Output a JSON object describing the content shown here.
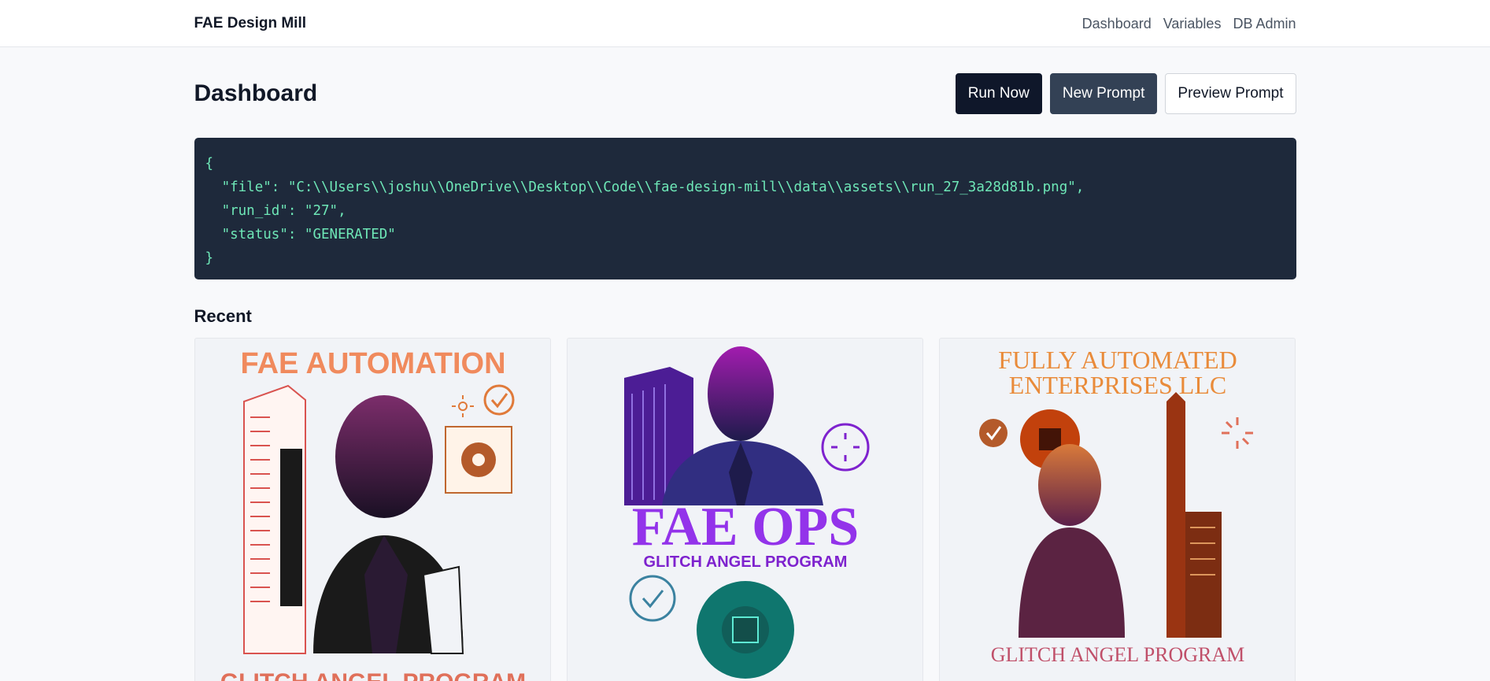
{
  "app": {
    "brand": "FAE Design Mill",
    "nav": [
      "Dashboard",
      "Variables",
      "DB Admin"
    ]
  },
  "page": {
    "title": "Dashboard",
    "buttons": {
      "run_now": "Run Now",
      "new_prompt": "New Prompt",
      "preview_prompt": "Preview Prompt"
    }
  },
  "result_json": "{\n  \"file\": \"C:\\\\Users\\\\joshu\\\\OneDrive\\\\Desktop\\\\Code\\\\fae-design-mill\\\\data\\\\assets\\\\run_27_3a28d81b.png\",\n  \"run_id\": \"27\",\n  \"status\": \"GENERATED\"\n}",
  "recent": {
    "title": "Recent",
    "cards": [
      {
        "headline": "FAE AUTOMATION",
        "footer": "GLITCH ANGEL PROGRAM"
      },
      {
        "headline": "FAE OPS",
        "subline": "GLITCH ANGEL PROGRAM"
      },
      {
        "headline_line1": "FULLY AUTOMATED",
        "headline_line2": "ENTERPRISES LLC",
        "footer": "GLITCH ANGEL PROGRAM"
      }
    ]
  },
  "colors": {
    "accent_dark": "#0f172a",
    "accent_slate": "#334155",
    "code_bg": "#1e293b",
    "code_text": "#6ee7b7"
  }
}
